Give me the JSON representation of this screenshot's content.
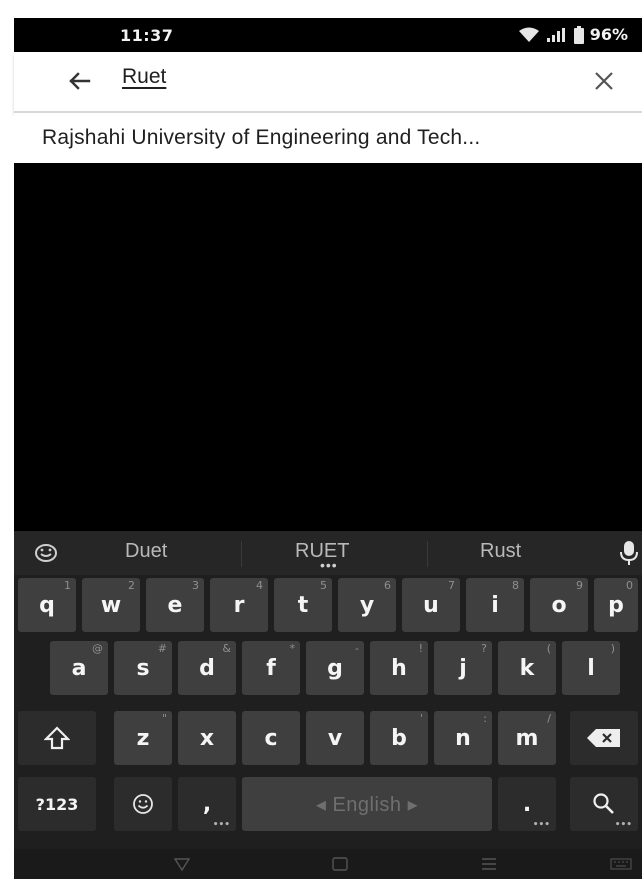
{
  "status_bar": {
    "time": "11:37",
    "battery": "96%"
  },
  "search": {
    "query": "Ruet",
    "back_icon": "arrow-left-icon",
    "clear_icon": "close-icon"
  },
  "suggestion": {
    "text": "Rajshahi University of Engineering and Tech..."
  },
  "keyboard": {
    "suggestions": [
      "Duet",
      "RUET",
      "Rust"
    ],
    "row1": [
      {
        "key": "q",
        "hint": "1"
      },
      {
        "key": "w",
        "hint": "2"
      },
      {
        "key": "e",
        "hint": "3"
      },
      {
        "key": "r",
        "hint": "4"
      },
      {
        "key": "t",
        "hint": "5"
      },
      {
        "key": "y",
        "hint": "6"
      },
      {
        "key": "u",
        "hint": "7"
      },
      {
        "key": "i",
        "hint": "8"
      },
      {
        "key": "o",
        "hint": "9"
      },
      {
        "key": "p",
        "hint": "0"
      }
    ],
    "row2": [
      {
        "key": "a",
        "hint": "@"
      },
      {
        "key": "s",
        "hint": "#"
      },
      {
        "key": "d",
        "hint": "&"
      },
      {
        "key": "f",
        "hint": "*"
      },
      {
        "key": "g",
        "hint": "-"
      },
      {
        "key": "h",
        "hint": "!"
      },
      {
        "key": "j",
        "hint": "?"
      },
      {
        "key": "k",
        "hint": "("
      },
      {
        "key": "l",
        "hint": ")"
      }
    ],
    "row3": [
      {
        "key": "z",
        "hint": "\""
      },
      {
        "key": "x",
        "hint": ""
      },
      {
        "key": "c",
        "hint": ""
      },
      {
        "key": "v",
        "hint": ""
      },
      {
        "key": "b",
        "hint": "'"
      },
      {
        "key": "n",
        "hint": ":"
      },
      {
        "key": "m",
        "hint": "/"
      }
    ],
    "symbols_label": "?123",
    "comma": ",",
    "space_label": "◂ English ▸",
    "period": "."
  },
  "colors": {
    "keyboard_bg": "#1f1f1f",
    "key_bg": "#3f3f3f",
    "key_dark_bg": "#2c2c2c"
  }
}
